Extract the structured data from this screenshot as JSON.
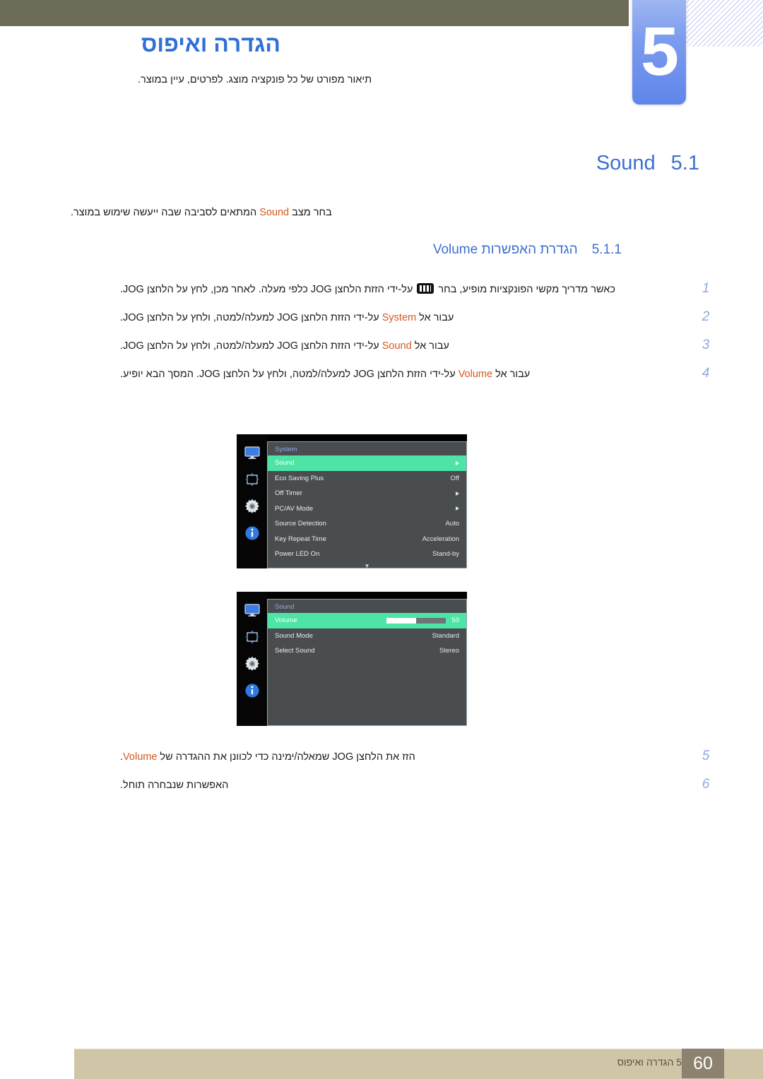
{
  "header": {
    "chapter_number": "5",
    "chapter_title": "הגדרה ואיפוס",
    "chapter_subtitle": "תיאור מפורט של כל פונקציה מוצג. לפרטים, עיין במוצר."
  },
  "section": {
    "number": "5.1",
    "title": "Sound",
    "body_before": "בחר מצב ",
    "body_keyword": "Sound",
    "body_after": " המתאים לסביבה שבה ייעשה שימוש במוצר."
  },
  "subsection": {
    "number": "5.1.1",
    "title_text": "הגדרת האפשרות ",
    "title_keyword": "Volume"
  },
  "steps_upper": [
    {
      "num": "1",
      "parts": [
        {
          "type": "text",
          "value": "כאשר מדריך מקשי הפונקציות מופיע, בחר "
        },
        {
          "type": "icon",
          "value": "jog-keyguide-icon"
        },
        {
          "type": "text",
          "value": " על-ידי הזזת הלחצן JOG כלפי מעלה. לאחר מכן, לחץ על הלחצן JOG."
        }
      ]
    },
    {
      "num": "2",
      "parts": [
        {
          "type": "text",
          "value": "עבור אל "
        },
        {
          "type": "keyword",
          "value": "System"
        },
        {
          "type": "text",
          "value": " על-ידי הזזת הלחצן JOG למעלה/למטה, ולחץ על הלחצן JOG."
        }
      ]
    },
    {
      "num": "3",
      "parts": [
        {
          "type": "text",
          "value": "עבור אל "
        },
        {
          "type": "keyword",
          "value": "Sound"
        },
        {
          "type": "text",
          "value": " על-ידי הזזת הלחצן JOG למעלה/למטה, ולחץ על הלחצן JOG."
        }
      ]
    },
    {
      "num": "4",
      "parts": [
        {
          "type": "text",
          "value": "עבור אל "
        },
        {
          "type": "keyword",
          "value": "Volume"
        },
        {
          "type": "text",
          "value": " על-ידי הזזת הלחצן JOG למעלה/למטה, ולחץ על הלחצן JOG. המסך הבא יופיע."
        }
      ]
    }
  ],
  "steps_lower": [
    {
      "num": "5",
      "parts": [
        {
          "type": "text",
          "value": "הזז את הלחצן JOG שמאלה/ימינה כדי לכוונן את ההגדרה של "
        },
        {
          "type": "keyword",
          "value": "Volume"
        },
        {
          "type": "text",
          "value": "."
        }
      ]
    },
    {
      "num": "6",
      "parts": [
        {
          "type": "text",
          "value": "האפשרות שנבחרה תוחל."
        }
      ]
    }
  ],
  "osd_system": {
    "title": "System",
    "rail_icons": [
      "monitor-icon",
      "size-position-icon",
      "gear-icon",
      "info-icon"
    ],
    "rows": [
      {
        "label": "Sound",
        "value": "",
        "arrow": true,
        "selected": true
      },
      {
        "label": "Eco Saving Plus",
        "value": "Off",
        "arrow": false,
        "selected": false
      },
      {
        "label": "Off Timer",
        "value": "",
        "arrow": true,
        "selected": false
      },
      {
        "label": "PC/AV Mode",
        "value": "",
        "arrow": true,
        "selected": false
      },
      {
        "label": "Source Detection",
        "value": "Auto",
        "arrow": false,
        "selected": false
      },
      {
        "label": "Key Repeat Time",
        "value": "Acceleration",
        "arrow": false,
        "selected": false
      },
      {
        "label": "Power LED On",
        "value": "Stand-by",
        "arrow": false,
        "selected": false
      }
    ],
    "more_indicator": "▼"
  },
  "osd_sound": {
    "title": "Sound",
    "rail_icons": [
      "monitor-icon",
      "size-position-icon",
      "gear-icon",
      "info-icon"
    ],
    "volume_label": "Volume",
    "volume_value": "50",
    "volume_percent": 50,
    "rows": [
      {
        "label": "Sound Mode",
        "value": "Standard"
      },
      {
        "label": "Select Sound",
        "value": "Stereo"
      }
    ]
  },
  "footer": {
    "text": "5 הגדרה ואיפוס",
    "page": "60"
  },
  "colors": {
    "accent_blue": "#3d6fd0",
    "keyword_orange": "#d4591f",
    "osd_highlight": "#4ee4a5",
    "top_band": "#6d6c58",
    "footer_band": "#d0c5a6"
  }
}
